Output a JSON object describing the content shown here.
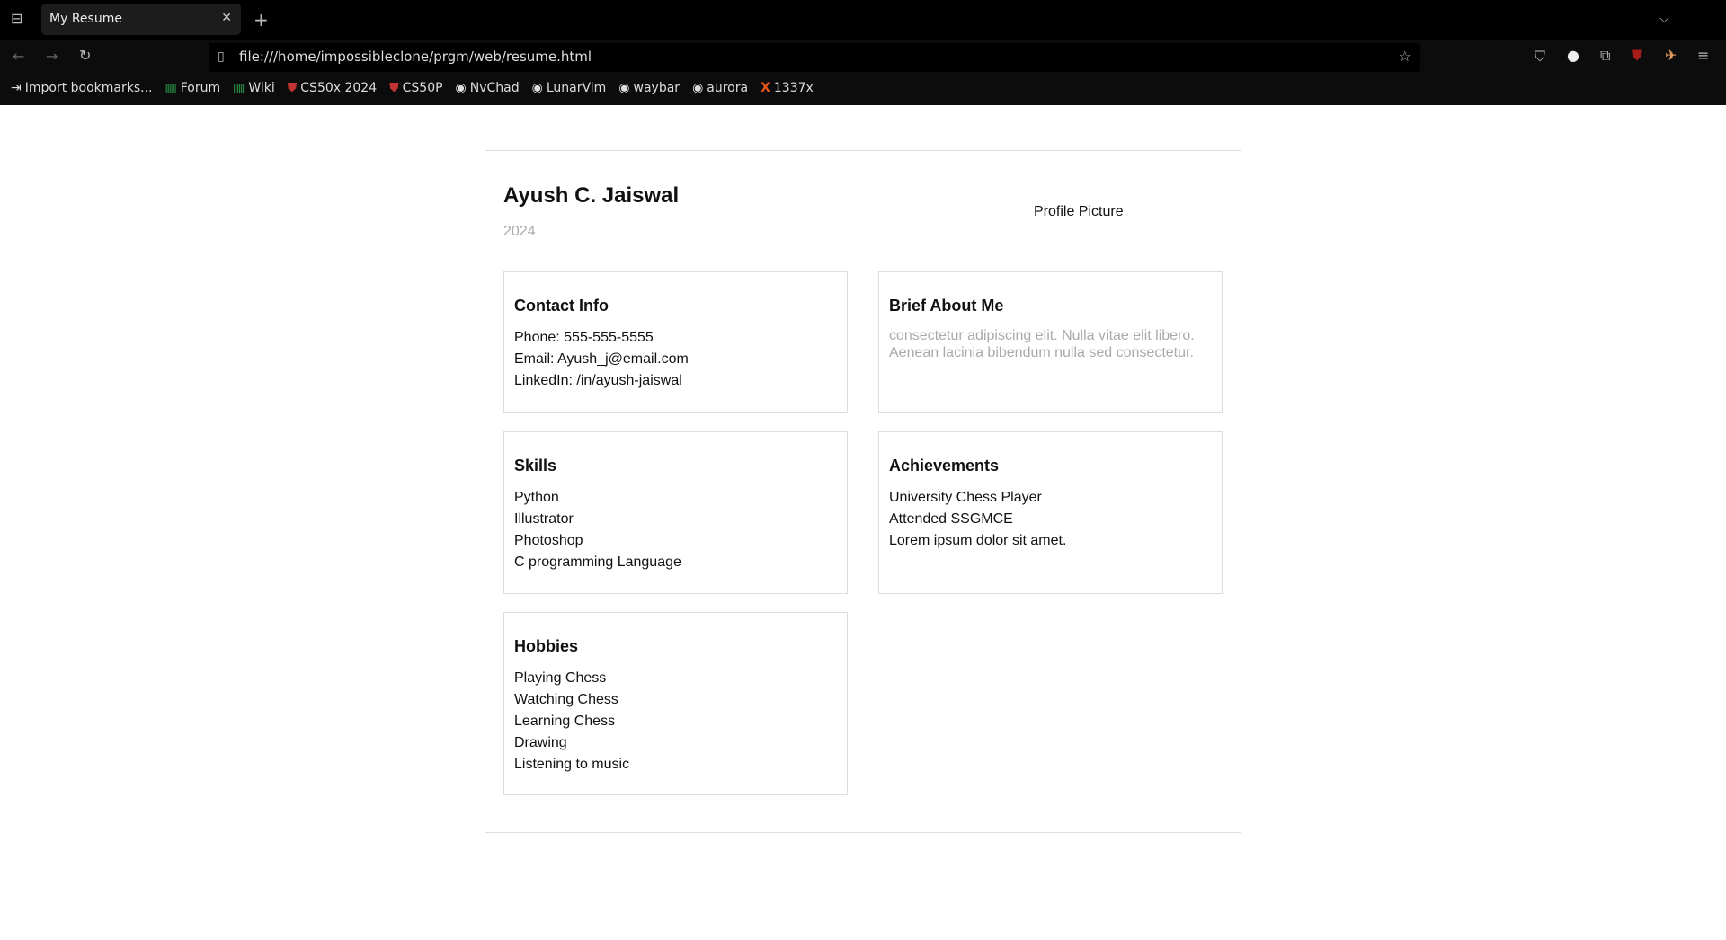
{
  "browser": {
    "tab_title": "My Resume",
    "url": "file:///home/impossibleclone/prgm/web/resume.html",
    "bookmarks": [
      {
        "label": "Import bookmarks...",
        "icon": "import-icon",
        "color": "#dddddd"
      },
      {
        "label": "Forum",
        "icon": "manjaro-icon",
        "color": "#35bf5c"
      },
      {
        "label": "Wiki",
        "icon": "manjaro-icon",
        "color": "#35bf5c"
      },
      {
        "label": "CS50x 2024",
        "icon": "harvard-shield-icon",
        "color": "#c23434"
      },
      {
        "label": "CS50P",
        "icon": "harvard-shield-icon",
        "color": "#c23434"
      },
      {
        "label": "NvChad",
        "icon": "github-icon",
        "color": "#dddddd"
      },
      {
        "label": "LunarVim",
        "icon": "github-icon",
        "color": "#dddddd"
      },
      {
        "label": "waybar",
        "icon": "github-icon",
        "color": "#dddddd"
      },
      {
        "label": "aurora",
        "icon": "github-icon",
        "color": "#dddddd"
      },
      {
        "label": "1337x",
        "icon": "x-logo-icon",
        "color": "#e8551e"
      }
    ]
  },
  "resume": {
    "name": "Ayush C. Jaiswal",
    "year": "2024",
    "profile_picture": "Profile Picture",
    "contact": {
      "title": "Contact Info",
      "lines": [
        "Phone: 555-555-5555",
        "Email: Ayush_j@email.com",
        "LinkedIn: /in/ayush-jaiswal"
      ]
    },
    "about": {
      "title": "Brief About Me",
      "lines": [
        "consectetur adipiscing elit. Nulla vitae elit libero.",
        "Aenean lacinia bibendum nulla sed consectetur."
      ]
    },
    "skills": {
      "title": "Skills",
      "lines": [
        "Python",
        "Illustrator",
        "Photoshop",
        "C programming Language"
      ]
    },
    "achievements": {
      "title": "Achievements",
      "lines": [
        "University Chess Player",
        "Attended SSGMCE",
        "Lorem ipsum dolor sit amet."
      ]
    },
    "hobbies": {
      "title": "Hobbies",
      "lines": [
        "Playing Chess",
        "Watching Chess",
        "Learning Chess",
        "Drawing",
        "Listening to music"
      ]
    }
  }
}
